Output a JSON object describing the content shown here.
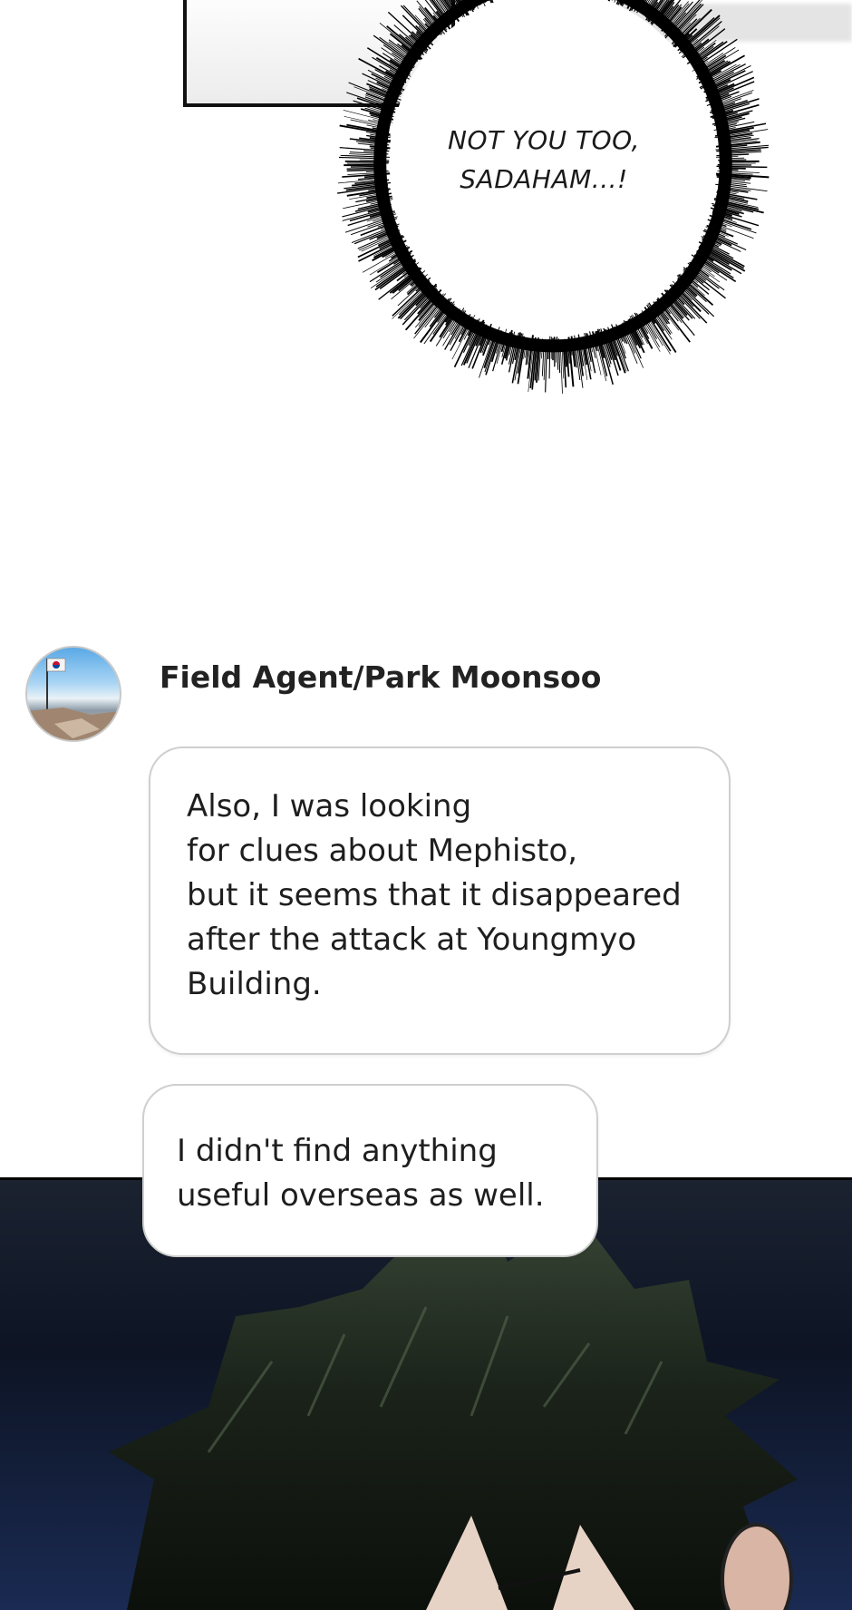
{
  "panel_top": {
    "speech_bubble_text": "NOT YOU TOO,\nSADAHAM...!"
  },
  "chat": {
    "sender_name": "Field Agent/Park Moonsoo",
    "messages": [
      {
        "text": "Also, I was looking\nfor clues about Mephisto,\nbut it seems that it disappeared\nafter the attack at Youngmyo\nBuilding."
      },
      {
        "text": "I didn't find anything\nuseful overseas as well."
      }
    ]
  },
  "colors": {
    "page_background": "#ffffff",
    "bubble_border": "#cfcfcf",
    "scene_background": "#0d1424"
  }
}
